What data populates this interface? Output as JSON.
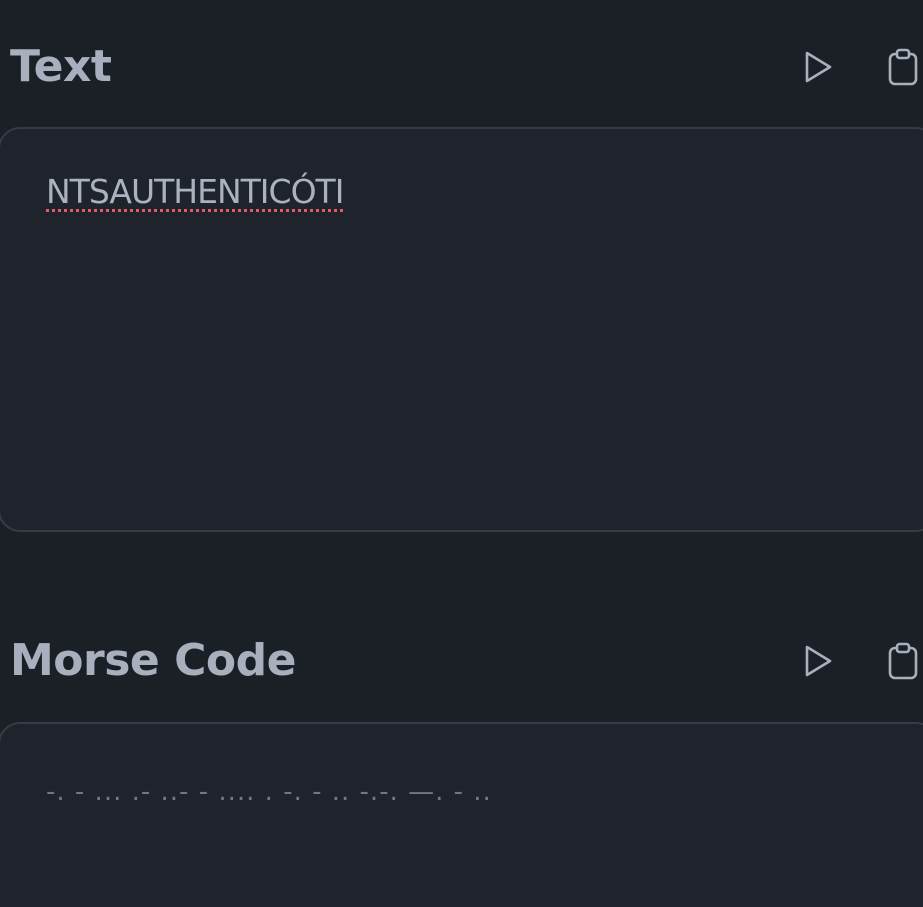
{
  "text_section": {
    "title": "Text",
    "value": "NTSAUTHENTICÓTI",
    "play_icon": "play-icon",
    "copy_icon": "clipboard-icon"
  },
  "morse_section": {
    "title": "Morse Code",
    "value": "-. - ... .- ..- - .... . -. - .. -.-. —. - ..",
    "play_icon": "play-icon",
    "copy_icon": "clipboard-icon"
  },
  "colors": {
    "background": "#1b1f26",
    "panel": "#1f232b",
    "panel_border": "#363b45",
    "title_text": "#a9b0bd",
    "body_text": "#aab1bf",
    "morse_text": "#717783",
    "spellcheck_underline": "#e05a6a"
  }
}
